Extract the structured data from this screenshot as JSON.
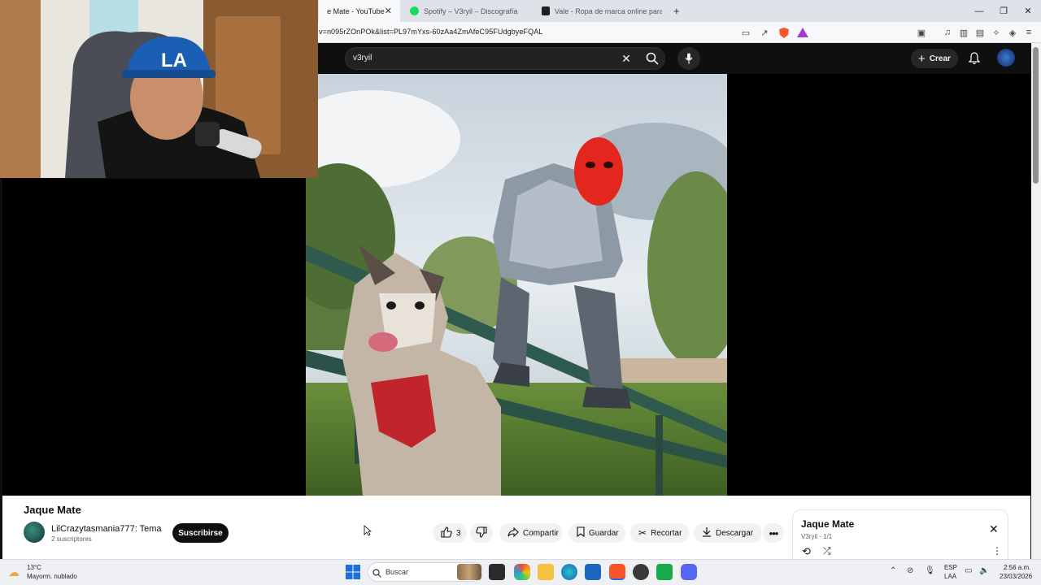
{
  "browser": {
    "tabs": [
      {
        "label": "Jaque Mate - YouTube",
        "active": true
      },
      {
        "label": "Spotify – V3ryil – Discografía",
        "active": false
      },
      {
        "label": "Vale - Ropa de marca online para ho",
        "active": false
      }
    ],
    "url": "v=n095rZOnPOk&list=PL97mYxs-60zAa4ZmAfeC95FUdgbyeFQAL"
  },
  "youtube": {
    "search_value": "v3ryil",
    "create_label": "Crear"
  },
  "video": {
    "title": "Jaque Mate",
    "channel_name": "LilCrazytasmania777: Tema",
    "subscribers": "2 suscriptores",
    "subscribe_label": "Suscribirse",
    "like_count": "3",
    "share_label": "Compartir",
    "save_label": "Guardar",
    "clip_label": "Recortar",
    "download_label": "Descargar"
  },
  "playlist": {
    "title": "Jaque Mate",
    "subtitle": "V3ryil - 1/1"
  },
  "taskbar": {
    "temperature": "13°C",
    "weather": "Mayorm. nublado",
    "search_placeholder": "Buscar",
    "lang_1": "ESP",
    "lang_2": "LAA",
    "time": "2:56 a.m.",
    "date": "23/03/2026"
  },
  "colors": {
    "accent_red": "#ff0033",
    "youtube_dark": "#0f0f0f"
  }
}
